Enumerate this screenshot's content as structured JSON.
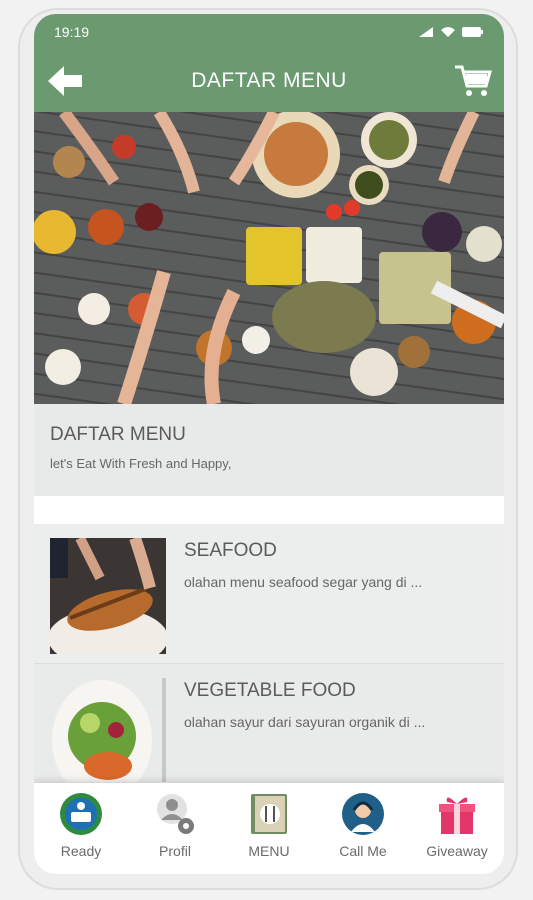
{
  "status_bar": {
    "time": "19:19"
  },
  "app_bar": {
    "title": "DAFTAR MENU"
  },
  "intro": {
    "title": "DAFTAR MENU",
    "subtitle": "let's Eat With Fresh and Happy,"
  },
  "menu_items": [
    {
      "title": "SEAFOOD",
      "description": "olahan menu seafood segar yang di ..."
    },
    {
      "title": "VEGETABLE FOOD",
      "description": "olahan sayur dari sayuran organik di ..."
    }
  ],
  "bottom_nav": [
    {
      "label": "Ready",
      "icon": "great-food-logo-icon"
    },
    {
      "label": "Profil",
      "icon": "profile-settings-icon"
    },
    {
      "label": "MENU",
      "icon": "menu-book-icon"
    },
    {
      "label": "Call Me",
      "icon": "support-agent-icon"
    },
    {
      "label": "Giveaway",
      "icon": "gift-icon"
    }
  ],
  "colors": {
    "header_green": "#6b9a70",
    "text_gray": "#5b5b5b"
  }
}
